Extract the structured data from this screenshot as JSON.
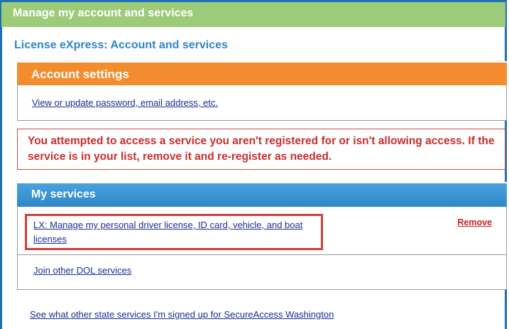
{
  "top_bar": {
    "title": "Manage my account and services"
  },
  "subheading": "License eXpress: Account and services",
  "account_settings": {
    "title": "Account settings",
    "link": "View or update password, email address, etc."
  },
  "error_message": "You attempted to access a service you aren't registered for or isn't allowing access. If the service is in your list, remove it and re-register as needed.",
  "my_services": {
    "title": "My services",
    "items": [
      {
        "label": "LX: Manage my personal driver license, ID card, vehicle, and boat licenses",
        "action": "Remove"
      }
    ],
    "join_link": "Join other DOL services"
  },
  "footer_link": "See what other state services I'm signed up for SecureAccess Washington",
  "colors": {
    "top_bar": "#9ccb7a",
    "account_header": "#f28c2e",
    "services_header": "#2f86c6",
    "error_text": "#cc2c2c",
    "highlight_border": "#d0403c"
  }
}
